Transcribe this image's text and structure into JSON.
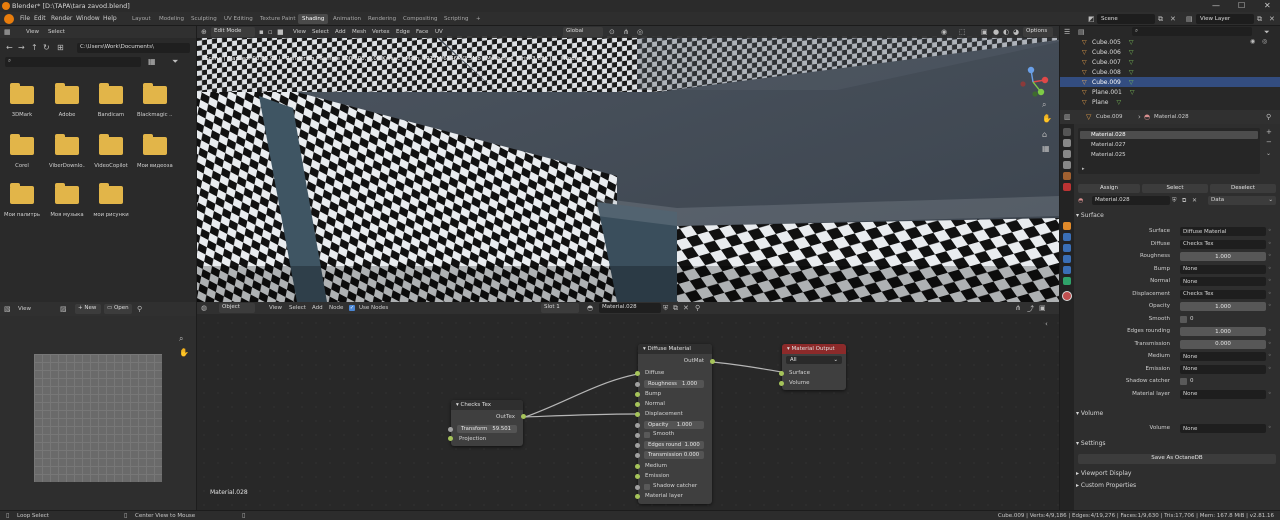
{
  "window": {
    "title": "Blender* [D:\\TAPA\\tara zavod.blend]",
    "minimize": "—",
    "maximize": "☐",
    "close": "✕"
  },
  "menu": {
    "file": "File",
    "edit": "Edit",
    "render": "Render",
    "window": "Window",
    "help": "Help"
  },
  "workspaces": [
    "Layout",
    "Modeling",
    "Sculpting",
    "UV Editing",
    "Texture Paint",
    "Shading",
    "Animation",
    "Rendering",
    "Compositing",
    "Scripting"
  ],
  "active_workspace": "Shading",
  "add_workspace": "+",
  "scene": {
    "scene_name": "Scene",
    "view_layer": "View Layer"
  },
  "filebrowser": {
    "view": "View",
    "select": "Select",
    "path": "C:\\Users\\Work\\Documents\\",
    "folders": [
      "3DMark",
      "Adobe",
      "Bandicam",
      "Blackmagic ...",
      "Corel",
      "ViberDownlo...",
      "VideoCopilot",
      "Мои видеоза...",
      "Мои палитры",
      "Моя музыка",
      "мои рисунки"
    ]
  },
  "viewport": {
    "mode": "Edit Mode",
    "menus": [
      "View",
      "Select",
      "Add",
      "Mesh",
      "Vertex",
      "Edge",
      "Face",
      "UV"
    ],
    "orientation": "Global",
    "options": "Options",
    "status": "Scene | Elapsed: 00:03.95 | - Rendering | Sample 100/100, 0.00 Ka/sec | Mem: 1912M/6146M/3.5Mb | Meshes: 1 | Tris: 3,636 | ... | Nodes: 1/4"
  },
  "imgeditor": {
    "view": "View",
    "new": "New",
    "open": "Open"
  },
  "nodeeditor": {
    "type": "Object",
    "menus": [
      "View",
      "Select",
      "Add",
      "Node"
    ],
    "use_nodes": "Use Nodes",
    "slot": "Slot 1",
    "material": "Material.028",
    "overlay_label": "Material.028",
    "checks_node": {
      "title": "Checks Tex",
      "out": "OutTex",
      "transform_label": "Transform",
      "transform_value": "59.501",
      "projection": "Projection"
    },
    "diffuse_node": {
      "title": "Diffuse Material",
      "out": "OutMat",
      "rows": {
        "diffuse": "Diffuse",
        "roughness_label": "Roughness",
        "roughness_value": "1.000",
        "bump": "Bump",
        "normal": "Normal",
        "displacement": "Displacement",
        "opacity_label": "Opacity",
        "opacity_value": "1.000",
        "smooth": "Smooth",
        "edges_label": "Edges round",
        "edges_value": "1.000",
        "trans_label": "Transmission",
        "trans_value": "0.000",
        "medium": "Medium",
        "emission": "Emission",
        "shadow": "Shadow catcher",
        "matlayer": "Material layer"
      }
    },
    "output_node": {
      "title": "Material Output",
      "target": "All",
      "surface": "Surface",
      "volume": "Volume"
    }
  },
  "outliner": {
    "items": [
      "Cube.005",
      "Cube.006",
      "Cube.007",
      "Cube.008",
      "Cube.009",
      "Plane.001",
      "Plane"
    ]
  },
  "properties": {
    "object": "Cube.009",
    "material": "Material.028",
    "slots": [
      "Material.028",
      "Material.027",
      "Material.025"
    ],
    "assign": "Assign",
    "select": "Select",
    "deselect": "Deselect",
    "mat_name": "Material.028",
    "link": "Data",
    "surface_section": "Surface",
    "rows": [
      {
        "label": "Surface",
        "value": "Diffuse Material",
        "kind": "field"
      },
      {
        "label": "Diffuse",
        "value": "Checks Tex",
        "kind": "field"
      },
      {
        "label": "Roughness",
        "value": "1.000",
        "kind": "num"
      },
      {
        "label": "Bump",
        "value": "None",
        "kind": "field"
      },
      {
        "label": "Normal",
        "value": "None",
        "kind": "field"
      },
      {
        "label": "Displacement",
        "value": "Checks Tex",
        "kind": "field"
      },
      {
        "label": "Opacity",
        "value": "1.000",
        "kind": "num"
      },
      {
        "label": "Smooth",
        "value": "0",
        "kind": "check"
      },
      {
        "label": "Edges rounding",
        "value": "1.000",
        "kind": "num"
      },
      {
        "label": "Transmission",
        "value": "0.000",
        "kind": "num"
      },
      {
        "label": "Medium",
        "value": "None",
        "kind": "field"
      },
      {
        "label": "Emission",
        "value": "None",
        "kind": "field"
      },
      {
        "label": "Shadow catcher",
        "value": "0",
        "kind": "check"
      },
      {
        "label": "Material layer",
        "value": "None",
        "kind": "field"
      }
    ],
    "volume_section": "Volume",
    "volume_label": "Volume",
    "volume_value": "None",
    "settings_section": "Settings",
    "save_octane": "Save As OctaneDB",
    "viewport_display": "Viewport Display",
    "custom_props": "Custom Properties"
  },
  "statusbar": {
    "left": "Loop Select",
    "middle": "Center View to Mouse",
    "right": "Cube.009 | Verts:4/9,186 | Edges:4/19,276 | Faces:1/9,630 | Tris:17,706 | Mem: 167.8 MiB | v2.81.16"
  }
}
